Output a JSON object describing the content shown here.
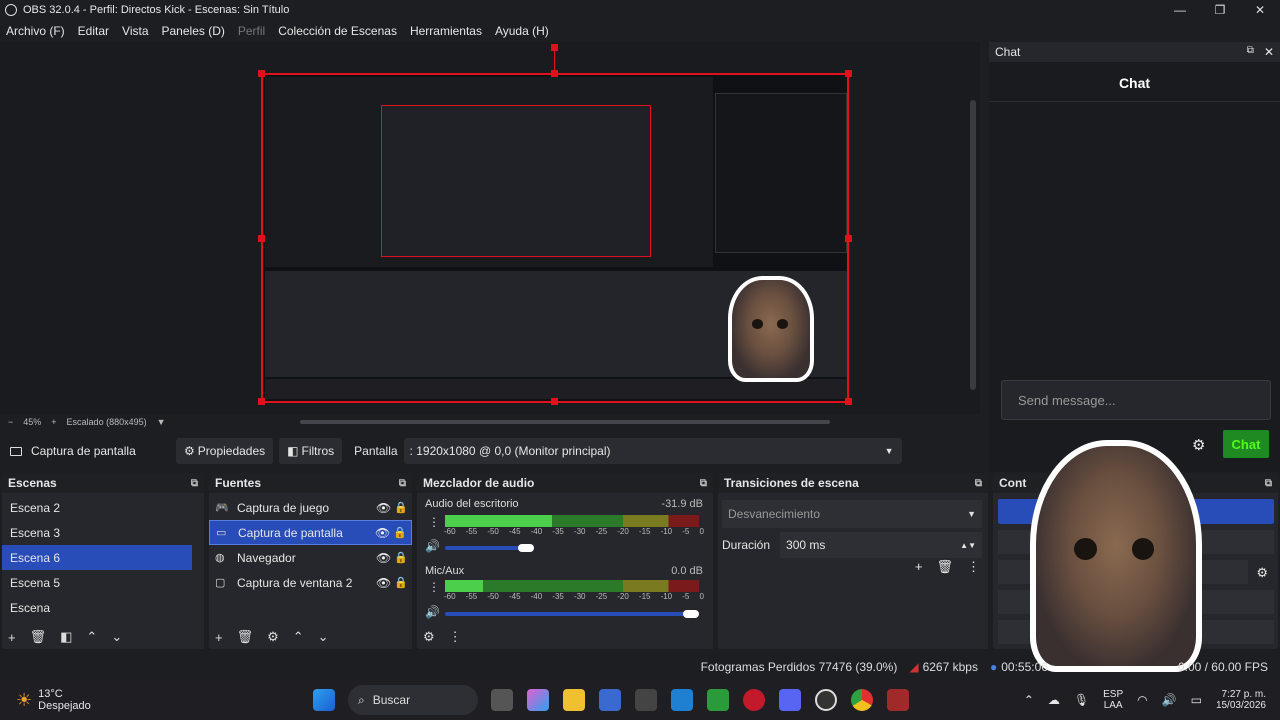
{
  "window": {
    "title": "OBS 32.0.4 - Perfil: Directos Kick - Escenas: Sin Título",
    "minimize": "—",
    "maximize": "❐",
    "close": "✕"
  },
  "menu": [
    "Archivo (F)",
    "Editar",
    "Vista",
    "Paneles (D)",
    "Perfil",
    "Colección de Escenas",
    "Herramientas",
    "Ayuda (H)"
  ],
  "zoom": {
    "minus": "−",
    "value": "45%",
    "plus": "+",
    "scaling": "Escalado (880x495)"
  },
  "source_toolbar": {
    "selected_source": "Captura de pantalla",
    "properties": "Propiedades",
    "filters": "Filtros",
    "display_label": "Pantalla",
    "display_value": ": 1920x1080 @ 0,0 (Monitor principal)"
  },
  "scenes": {
    "title": "Escenas",
    "items": [
      "Escena 2",
      "Escena 3",
      "Escena 6",
      "Escena 5",
      "Escena"
    ],
    "selected_index": 2
  },
  "sources": {
    "title": "Fuentes",
    "items": [
      {
        "name": "Captura de juego",
        "icon": "gamepad-icon"
      },
      {
        "name": "Captura de pantalla",
        "icon": "monitor-icon"
      },
      {
        "name": "Navegador",
        "icon": "globe-icon"
      },
      {
        "name": "Captura de ventana 2",
        "icon": "window-icon"
      }
    ],
    "selected_index": 1
  },
  "mixer": {
    "title": "Mezclador de audio",
    "channels": [
      {
        "name": "Audio del escritorio",
        "db": "-31.9 dB",
        "level": 0.42,
        "volume": 0.35
      },
      {
        "name": "Mic/Aux",
        "db": "0.0 dB",
        "level": 0.15,
        "volume": 1.0
      }
    ],
    "scale": [
      "-60",
      "-55",
      "-50",
      "-45",
      "-40",
      "-35",
      "-30",
      "-25",
      "-20",
      "-15",
      "-10",
      "-5",
      "0"
    ]
  },
  "transitions": {
    "title": "Transiciones de escena",
    "selected": "Desvanecimiento",
    "duration_label": "Duración",
    "duration_value": "300 ms"
  },
  "controls": {
    "title": "Cont"
  },
  "chat": {
    "dock_title": "Chat",
    "heading": "Chat",
    "placeholder": "Send message...",
    "send": "Chat"
  },
  "status": {
    "dropped_frames": "Fotogramas Perdidos 77476 (39.0%)",
    "bitrate": "6267 kbps",
    "time": "00:55:06",
    "fps": "0.00 / 60.00 FPS"
  },
  "taskbar": {
    "weather_temp": "13°C",
    "weather_desc": "Despejado",
    "search": "Buscar",
    "lang_top": "ESP",
    "lang_bottom": "LAA",
    "time": "7:27 p. m.",
    "date": "15/03/2026"
  },
  "colors": {
    "accent": "#284cb8",
    "send_button": "#1f8a22",
    "selection_border": "#e0101c"
  }
}
